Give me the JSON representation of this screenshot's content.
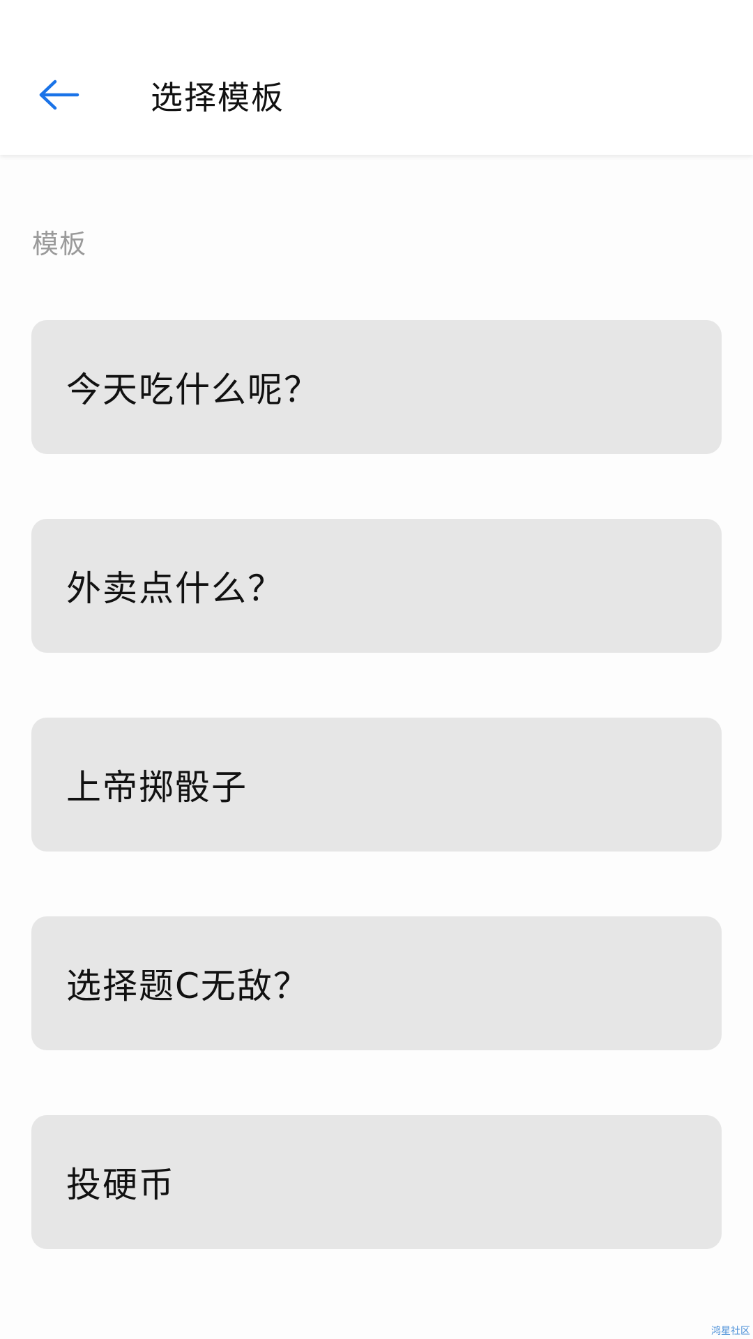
{
  "header": {
    "title": "选择模板",
    "back_icon": "arrow-left-icon",
    "accent_color": "#1a73e8"
  },
  "section": {
    "label": "模板"
  },
  "templates": [
    {
      "label": "今天吃什么呢？"
    },
    {
      "label": "外卖点什么？"
    },
    {
      "label": "上帝掷骰子"
    },
    {
      "label": "选择题C无敌？"
    },
    {
      "label": "投硬币"
    }
  ],
  "watermark": {
    "text": "鸿星社区"
  }
}
